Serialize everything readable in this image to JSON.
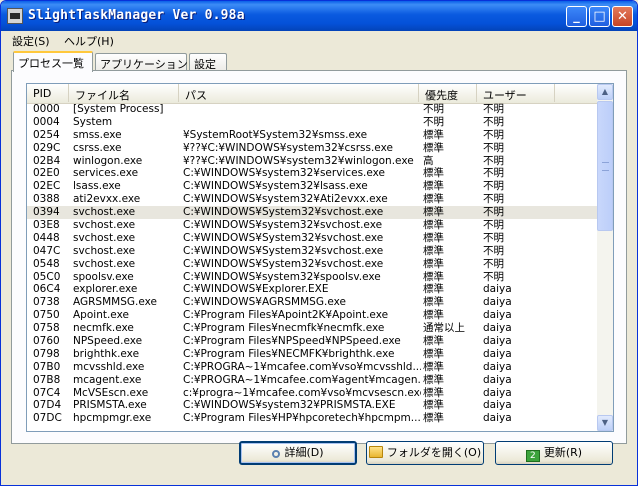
{
  "window": {
    "title": "SlightTaskManager Ver 0.98a"
  },
  "title_buttons": {
    "minimize": "_",
    "maximize": "□",
    "close": "✕"
  },
  "menu": [
    "設定(S)",
    "ヘルプ(H)"
  ],
  "tabs": [
    "プロセス一覧",
    "アプリケーション",
    "設定"
  ],
  "columns": {
    "pid": "PID",
    "name": "ファイル名",
    "path": "パス",
    "priority": "優先度",
    "user": "ユーザー"
  },
  "processes": [
    {
      "pid": "0000",
      "name": "[System Process]",
      "path": "",
      "priority": "不明",
      "user": "不明"
    },
    {
      "pid": "0004",
      "name": "System",
      "path": "",
      "priority": "不明",
      "user": "不明"
    },
    {
      "pid": "0254",
      "name": "smss.exe",
      "path": "¥SystemRoot¥System32¥smss.exe",
      "priority": "標準",
      "user": "不明"
    },
    {
      "pid": "029C",
      "name": "csrss.exe",
      "path": "¥??¥C:¥WINDOWS¥system32¥csrss.exe",
      "priority": "標準",
      "user": "不明"
    },
    {
      "pid": "02B4",
      "name": "winlogon.exe",
      "path": "¥??¥C:¥WINDOWS¥system32¥winlogon.exe",
      "priority": "高",
      "user": "不明"
    },
    {
      "pid": "02E0",
      "name": "services.exe",
      "path": "C:¥WINDOWS¥system32¥services.exe",
      "priority": "標準",
      "user": "不明"
    },
    {
      "pid": "02EC",
      "name": "lsass.exe",
      "path": "C:¥WINDOWS¥system32¥lsass.exe",
      "priority": "標準",
      "user": "不明"
    },
    {
      "pid": "0388",
      "name": "ati2evxx.exe",
      "path": "C:¥WINDOWS¥system32¥Ati2evxx.exe",
      "priority": "標準",
      "user": "不明"
    },
    {
      "pid": "0394",
      "name": "svchost.exe",
      "path": "C:¥WINDOWS¥System32¥svchost.exe",
      "priority": "標準",
      "user": "不明"
    },
    {
      "pid": "03E8",
      "name": "svchost.exe",
      "path": "C:¥WINDOWS¥system32¥svchost.exe",
      "priority": "標準",
      "user": "不明"
    },
    {
      "pid": "0448",
      "name": "svchost.exe",
      "path": "C:¥WINDOWS¥System32¥svchost.exe",
      "priority": "標準",
      "user": "不明"
    },
    {
      "pid": "047C",
      "name": "svchost.exe",
      "path": "C:¥WINDOWS¥System32¥svchost.exe",
      "priority": "標準",
      "user": "不明"
    },
    {
      "pid": "0548",
      "name": "svchost.exe",
      "path": "C:¥WINDOWS¥System32¥svchost.exe",
      "priority": "標準",
      "user": "不明"
    },
    {
      "pid": "05C0",
      "name": "spoolsv.exe",
      "path": "C:¥WINDOWS¥system32¥spoolsv.exe",
      "priority": "標準",
      "user": "不明"
    },
    {
      "pid": "06C4",
      "name": "explorer.exe",
      "path": "C:¥WINDOWS¥Explorer.EXE",
      "priority": "標準",
      "user": "daiya"
    },
    {
      "pid": "0738",
      "name": "AGRSMMSG.exe",
      "path": "C:¥WINDOWS¥AGRSMMSG.exe",
      "priority": "標準",
      "user": "daiya"
    },
    {
      "pid": "0750",
      "name": "Apoint.exe",
      "path": "C:¥Program Files¥Apoint2K¥Apoint.exe",
      "priority": "標準",
      "user": "daiya"
    },
    {
      "pid": "0758",
      "name": "necmfk.exe",
      "path": "C:¥Program Files¥necmfk¥necmfk.exe",
      "priority": "通常以上",
      "user": "daiya"
    },
    {
      "pid": "0760",
      "name": "NPSpeed.exe",
      "path": "C:¥Program Files¥NPSpeed¥NPSpeed.exe",
      "priority": "標準",
      "user": "daiya"
    },
    {
      "pid": "0798",
      "name": "brighthk.exe",
      "path": "C:¥Program Files¥NECMFK¥brighthk.exe",
      "priority": "標準",
      "user": "daiya"
    },
    {
      "pid": "07B0",
      "name": "mcvsshld.exe",
      "path": "C:¥PROGRA~1¥mcafee.com¥vso¥mcvsshld...",
      "priority": "標準",
      "user": "daiya"
    },
    {
      "pid": "07B8",
      "name": "mcagent.exe",
      "path": "C:¥PROGRA~1¥mcafee.com¥agent¥mcagen...",
      "priority": "標準",
      "user": "daiya"
    },
    {
      "pid": "07C4",
      "name": "McVSEscn.exe",
      "path": "c:¥progra~1¥mcafee.com¥vso¥mcvsescn.exe",
      "priority": "標準",
      "user": "daiya"
    },
    {
      "pid": "07D4",
      "name": "PRISMSTA.exe",
      "path": "C:¥WINDOWS¥system32¥PRISMSTA.EXE",
      "priority": "標準",
      "user": "daiya"
    },
    {
      "pid": "07DC",
      "name": "hpcmpmgr.exe",
      "path": "C:¥Program Files¥HP¥hpcoretech¥hpcmpm...",
      "priority": "標準",
      "user": "daiya"
    }
  ],
  "selected_row": 8,
  "scrollbar": {
    "up": "▲",
    "down": "▼"
  },
  "buttons": {
    "details": "詳細(D)",
    "open_folder": "フォルダを開く(O)",
    "refresh": "更新(R)",
    "refresh_glyph": "2"
  },
  "colors": {
    "title_blue": "#0451d8",
    "tab_highlight": "#ffc83c",
    "selected_row": "#e8e6de"
  }
}
